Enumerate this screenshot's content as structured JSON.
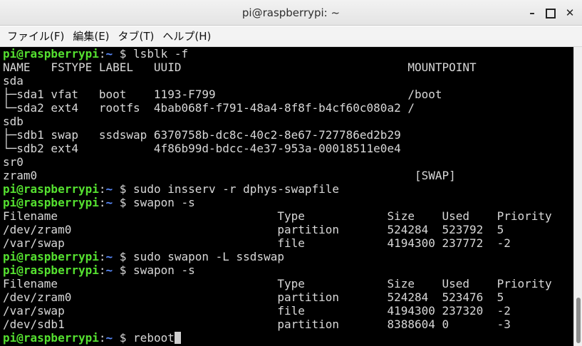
{
  "window": {
    "title": "pi@raspberrypi: ~",
    "minimize_glyph": "–",
    "close_glyph": "✕"
  },
  "menu": [
    "ファイル(F)",
    "編集(E)",
    "タブ(T)",
    "ヘルプ(H)"
  ],
  "prompt": {
    "user_host": "pi@raspberrypi",
    "sep": ":",
    "path": "~",
    "symbol": " $ "
  },
  "lines": [
    {
      "kind": "prompt",
      "cmd": "lsblk -f"
    },
    {
      "kind": "out",
      "text": "NAME   FSTYPE LABEL   UUID                                 MOUNTPOINT"
    },
    {
      "kind": "out",
      "text": "sda"
    },
    {
      "kind": "out",
      "text": "├─sda1 vfat   boot    1193-F799                            /boot"
    },
    {
      "kind": "out",
      "text": "└─sda2 ext4   rootfs  4bab068f-f791-48a4-8f8f-b4cf60c080a2 /"
    },
    {
      "kind": "out",
      "text": "sdb"
    },
    {
      "kind": "out",
      "text": "├─sdb1 swap   ssdswap 6370758b-dc8c-40c2-8e67-727786ed2b29"
    },
    {
      "kind": "out",
      "text": "└─sdb2 ext4           4f86b99d-bdcc-4e37-953a-00018511e0e4"
    },
    {
      "kind": "out",
      "text": "sr0"
    },
    {
      "kind": "out",
      "text": "zram0                                                       [SWAP]"
    },
    {
      "kind": "prompt",
      "cmd": "sudo insserv -r dphys-swapfile"
    },
    {
      "kind": "prompt",
      "cmd": "swapon -s"
    },
    {
      "kind": "out",
      "text": "Filename                                Type            Size    Used    Priority"
    },
    {
      "kind": "out",
      "text": "/dev/zram0                              partition       524284  523792  5"
    },
    {
      "kind": "out",
      "text": "/var/swap                               file            4194300 237772  -2"
    },
    {
      "kind": "prompt",
      "cmd": "sudo swapon -L ssdswap"
    },
    {
      "kind": "prompt",
      "cmd": "swapon -s"
    },
    {
      "kind": "out",
      "text": "Filename                                Type            Size    Used    Priority"
    },
    {
      "kind": "out",
      "text": "/dev/zram0                              partition       524284  523476  5"
    },
    {
      "kind": "out",
      "text": "/var/swap                               file            4194300 237320  -2"
    },
    {
      "kind": "out",
      "text": "/dev/sdb1                               partition       8388604 0       -3"
    },
    {
      "kind": "prompt",
      "cmd": "reboot",
      "cursor": true
    }
  ],
  "colors": {
    "terminal_bg": "#000000",
    "prompt_user": "#55e030",
    "prompt_path": "#5a8cff",
    "text": "#d8d8d8"
  }
}
